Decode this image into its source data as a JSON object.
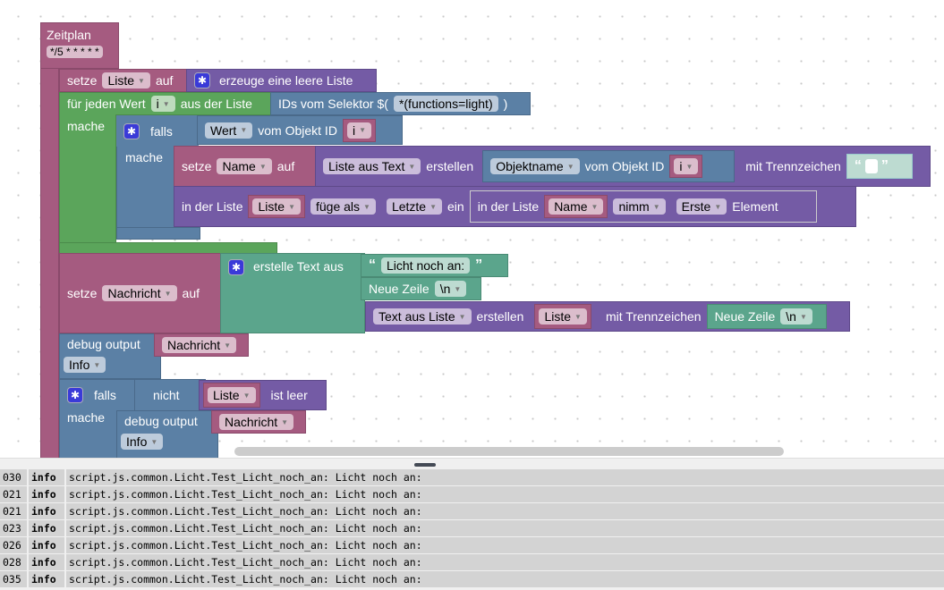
{
  "blocks": {
    "schedule": {
      "title": "Zeitplan",
      "cron": "*/5 * * * * *"
    },
    "set_list": {
      "set": "setze",
      "var": "Liste",
      "to": "auf",
      "create": "erzeuge eine leere Liste"
    },
    "for_each": {
      "label": "für jeden Wert",
      "var": "i",
      "from": "aus der Liste",
      "do": "mache"
    },
    "selector": {
      "label": "IDs vom Selektor $(",
      "value": "*(functions=light)",
      "close": ")"
    },
    "if1": {
      "if": "falls",
      "do": "mache",
      "prop": "Wert",
      "of": "vom Objekt ID",
      "id": "i"
    },
    "set_name": {
      "set": "setze",
      "var": "Name",
      "to": "auf",
      "mode": "Liste aus Text",
      "create": "erstellen",
      "prop": "Objektname",
      "of": "vom Objekt ID",
      "id": "i",
      "sep": "mit Trennzeichen"
    },
    "list_insert": {
      "in": "in der Liste",
      "list": "Liste",
      "mode": "füge als",
      "where": "Letzte",
      "insert": "ein",
      "in2": "in der Liste",
      "list2": "Name",
      "get": "nimm",
      "where2": "Erste",
      "elem": "Element"
    },
    "set_msg": {
      "set": "setze",
      "var": "Nachricht",
      "to": "auf",
      "join": "erstelle Text aus",
      "text1": "Licht noch an:",
      "newline": "Neue Zeile",
      "nl": "\\n",
      "mode": "Text aus Liste",
      "create": "erstellen",
      "list": "Liste",
      "sep": "mit Trennzeichen",
      "newline2": "Neue Zeile",
      "nl2": "\\n"
    },
    "debug1": {
      "label": "debug output",
      "var": "Nachricht",
      "level": "Info"
    },
    "if2": {
      "if": "falls",
      "not": "nicht",
      "list": "Liste",
      "empty": "ist leer",
      "do": "mache",
      "debug": "debug output",
      "var": "Nachricht",
      "level": "Info"
    }
  },
  "log": [
    {
      "t": "030",
      "level": "info",
      "msg": "script.js.common.Licht.Test_Licht_noch_an: Licht noch an:"
    },
    {
      "t": "021",
      "level": "info",
      "msg": "script.js.common.Licht.Test_Licht_noch_an: Licht noch an:"
    },
    {
      "t": "021",
      "level": "info",
      "msg": "script.js.common.Licht.Test_Licht_noch_an: Licht noch an:"
    },
    {
      "t": "023",
      "level": "info",
      "msg": "script.js.common.Licht.Test_Licht_noch_an: Licht noch an:"
    },
    {
      "t": "026",
      "level": "info",
      "msg": "script.js.common.Licht.Test_Licht_noch_an: Licht noch an:"
    },
    {
      "t": "028",
      "level": "info",
      "msg": "script.js.common.Licht.Test_Licht_noch_an: Licht noch an:"
    },
    {
      "t": "035",
      "level": "info",
      "msg": "script.js.common.Licht.Test_Licht_noch_an: Licht noch an:"
    }
  ]
}
